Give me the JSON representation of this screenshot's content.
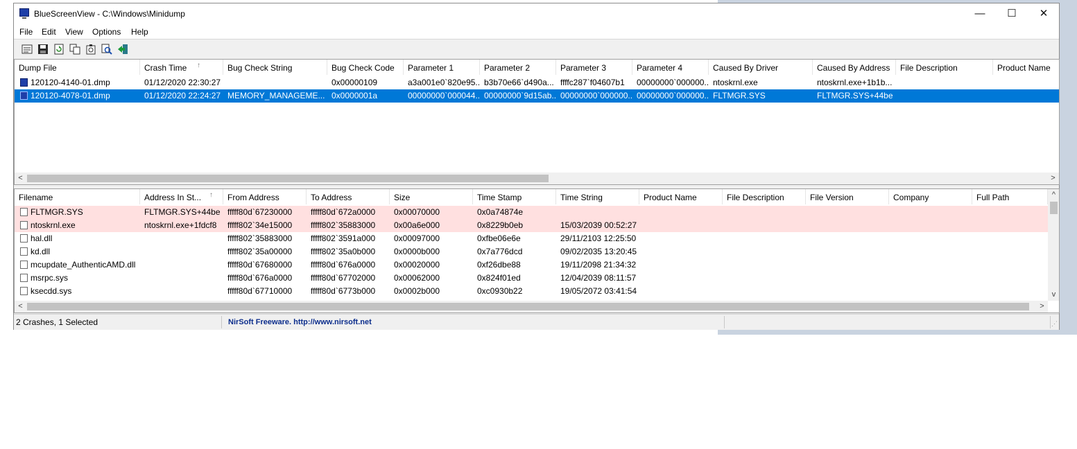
{
  "window": {
    "title": "BlueScreenView  -  C:\\Windows\\Minidump",
    "controls": {
      "minimize": "—",
      "maximize": "☐",
      "close": "✕"
    }
  },
  "menu": [
    "File",
    "Edit",
    "View",
    "Options",
    "Help"
  ],
  "toolbar": [
    "properties-icon",
    "save-icon",
    "refresh-icon",
    "copy-icon",
    "advanced-options-icon",
    "find-icon",
    "exit-icon"
  ],
  "dumps": {
    "columns": [
      "Dump File",
      "Crash Time",
      "Bug Check String",
      "Bug Check Code",
      "Parameter 1",
      "Parameter 2",
      "Parameter 3",
      "Parameter 4",
      "Caused By Driver",
      "Caused By Address",
      "File Description",
      "Product Name"
    ],
    "sort_indicator": "↑",
    "rows": [
      [
        "120120-4140-01.dmp",
        "01/12/2020 22:30:27",
        "",
        "0x00000109",
        "a3a001e0`820e95...",
        "b3b70e66`d490a...",
        "ffffc287`f04607b1",
        "00000000`000000...",
        "ntoskrnl.exe",
        "ntoskrnl.exe+1b1b...",
        "",
        ""
      ],
      [
        "120120-4078-01.dmp",
        "01/12/2020 22:24:27",
        "MEMORY_MANAGEME...",
        "0x0000001a",
        "00000000`000044...",
        "00000000`9d15ab...",
        "00000000`000000...",
        "00000000`000000...",
        "FLTMGR.SYS",
        "FLTMGR.SYS+44be",
        "",
        ""
      ]
    ],
    "selected_row": 1
  },
  "drivers": {
    "columns": [
      "Filename",
      "Address In St...",
      "From Address",
      "To Address",
      "Size",
      "Time Stamp",
      "Time String",
      "Product Name",
      "File Description",
      "File Version",
      "Company",
      "Full Path"
    ],
    "sort_indicator": "↑",
    "rows": [
      [
        "FLTMGR.SYS",
        "FLTMGR.SYS+44be",
        "fffff80d`67230000",
        "fffff80d`672a0000",
        "0x00070000",
        "0x0a74874e",
        "",
        "",
        "",
        "",
        "",
        ""
      ],
      [
        "ntoskrnl.exe",
        "ntoskrnl.exe+1fdcf8",
        "fffff802`34e15000",
        "fffff802`35883000",
        "0x00a6e000",
        "0x8229b0eb",
        "15/03/2039 00:52:27",
        "",
        "",
        "",
        "",
        ""
      ],
      [
        "hal.dll",
        "",
        "fffff802`35883000",
        "fffff802`3591a000",
        "0x00097000",
        "0xfbe06e6e",
        "29/11/2103 12:25:50",
        "",
        "",
        "",
        "",
        ""
      ],
      [
        "kd.dll",
        "",
        "fffff802`35a00000",
        "fffff802`35a0b000",
        "0x0000b000",
        "0x7a776dcd",
        "09/02/2035 13:20:45",
        "",
        "",
        "",
        "",
        ""
      ],
      [
        "mcupdate_AuthenticAMD.dll",
        "",
        "fffff80d`67680000",
        "fffff80d`676a0000",
        "0x00020000",
        "0xf26dbe88",
        "19/11/2098 21:34:32",
        "",
        "",
        "",
        "",
        ""
      ],
      [
        "msrpc.sys",
        "",
        "fffff80d`676a0000",
        "fffff80d`67702000",
        "0x00062000",
        "0x824f01ed",
        "12/04/2039 08:11:57",
        "",
        "",
        "",
        "",
        ""
      ],
      [
        "ksecdd.sys",
        "",
        "fffff80d`67710000",
        "fffff80d`6773b000",
        "0x0002b000",
        "0xc0930b22",
        "19/05/2072 03:41:54",
        "",
        "",
        "",
        "",
        ""
      ]
    ],
    "highlighted_rows": [
      0,
      1
    ]
  },
  "status": {
    "count": "2 Crashes, 1 Selected",
    "credit": "NirSoft Freeware.  http://www.nirsoft.net"
  },
  "colors": {
    "selection": "#0078d7",
    "highlight": "#ffe0e0",
    "link": "#0b2d8c"
  },
  "scroll_arrows": {
    "left": "<",
    "right": ">",
    "up": "^",
    "down": "v"
  }
}
